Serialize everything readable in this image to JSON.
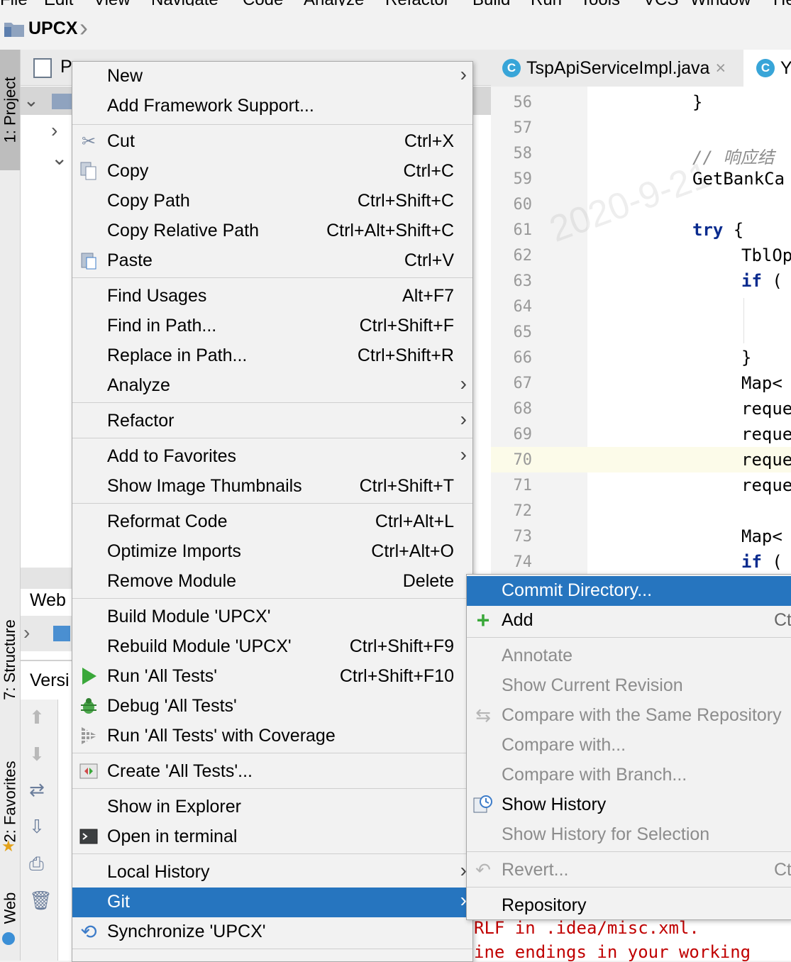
{
  "menubar": [
    "File",
    "Edit",
    "View",
    "Navigate",
    "Code",
    "Analyze",
    "Refactor",
    "Build",
    "Run",
    "Tools",
    "VCS",
    "Window",
    "Help"
  ],
  "navbar": {
    "project_name": "UPCX"
  },
  "left_stripe": {
    "project_tab": "1: Project",
    "structure_tab": "7: Structure",
    "favorites_tab": "2: Favorites",
    "web_tab": "Web"
  },
  "project_panel": {
    "title_initial": "P"
  },
  "web_panel": {
    "title": "Web"
  },
  "version_panel": {
    "title": "Versi"
  },
  "editor": {
    "tabs": [
      {
        "badge": "C",
        "label": "TspApiServiceImpl.java",
        "close": "×"
      },
      {
        "badge": "C",
        "label": "Y"
      }
    ],
    "lines": [
      {
        "n": "56",
        "code": "}"
      },
      {
        "n": "57",
        "code": ""
      },
      {
        "n": "58",
        "code": "// 响应结"
      },
      {
        "n": "59",
        "code": "GetBankCa"
      },
      {
        "n": "60",
        "code": ""
      },
      {
        "n": "61",
        "kw": "try",
        "code": " {"
      },
      {
        "n": "62",
        "code": "TblOp"
      },
      {
        "n": "63",
        "kw": "if",
        "code": " ("
      },
      {
        "n": "64",
        "code": ""
      },
      {
        "n": "65",
        "code": ""
      },
      {
        "n": "66",
        "code": "}"
      },
      {
        "n": "67",
        "code": "Map<"
      },
      {
        "n": "68",
        "code": "reque"
      },
      {
        "n": "69",
        "code": "reque"
      },
      {
        "n": "70",
        "code": "reque"
      },
      {
        "n": "71",
        "code": "reque"
      },
      {
        "n": "72",
        "code": ""
      },
      {
        "n": "73",
        "code": "Map<"
      },
      {
        "n": "74",
        "kw": "if",
        "code": " ("
      }
    ],
    "watermark": "2020-9-21"
  },
  "console": {
    "line1": "RLF in .idea/misc.xml.",
    "line2": "ine endings in your working"
  },
  "context_menu": {
    "new": {
      "label": "New"
    },
    "add_framework": {
      "label": "Add Framework Support..."
    },
    "cut": {
      "label": "Cut",
      "shortcut": "Ctrl+X"
    },
    "copy": {
      "label": "Copy",
      "shortcut": "Ctrl+C"
    },
    "copy_path": {
      "label": "Copy Path",
      "shortcut": "Ctrl+Shift+C"
    },
    "copy_relative_path": {
      "label": "Copy Relative Path",
      "shortcut": "Ctrl+Alt+Shift+C"
    },
    "paste": {
      "label": "Paste",
      "shortcut": "Ctrl+V"
    },
    "find_usages": {
      "label": "Find Usages",
      "shortcut": "Alt+F7"
    },
    "find_in_path": {
      "label": "Find in Path...",
      "shortcut": "Ctrl+Shift+F"
    },
    "replace_in_path": {
      "label": "Replace in Path...",
      "shortcut": "Ctrl+Shift+R"
    },
    "analyze": {
      "label": "Analyze"
    },
    "refactor": {
      "label": "Refactor"
    },
    "add_to_favorites": {
      "label": "Add to Favorites"
    },
    "show_image_thumbnails": {
      "label": "Show Image Thumbnails",
      "shortcut": "Ctrl+Shift+T"
    },
    "reformat_code": {
      "label": "Reformat Code",
      "shortcut": "Ctrl+Alt+L"
    },
    "optimize_imports": {
      "label": "Optimize Imports",
      "shortcut": "Ctrl+Alt+O"
    },
    "remove_module": {
      "label": "Remove Module",
      "shortcut": "Delete"
    },
    "build_module": {
      "label": "Build Module 'UPCX'"
    },
    "rebuild_module": {
      "label": "Rebuild Module 'UPCX'",
      "shortcut": "Ctrl+Shift+F9"
    },
    "run_tests": {
      "label": "Run 'All Tests'",
      "shortcut": "Ctrl+Shift+F10"
    },
    "debug_tests": {
      "label": "Debug 'All Tests'"
    },
    "run_coverage": {
      "label": "Run 'All Tests' with Coverage"
    },
    "create_tests": {
      "label": "Create 'All Tests'..."
    },
    "show_in_explorer": {
      "label": "Show in Explorer"
    },
    "open_in_terminal": {
      "label": "Open in terminal"
    },
    "local_history": {
      "label": "Local History"
    },
    "git": {
      "label": "Git"
    },
    "synchronize": {
      "label": "Synchronize 'UPCX'"
    }
  },
  "git_submenu": {
    "commit_directory": {
      "label": "Commit Directory..."
    },
    "add": {
      "label": "Add",
      "shortcut": "Ct"
    },
    "annotate": {
      "label": "Annotate"
    },
    "show_current_revision": {
      "label": "Show Current Revision"
    },
    "compare_same_repo": {
      "label": "Compare with the Same Repository"
    },
    "compare_with": {
      "label": "Compare with..."
    },
    "compare_branch": {
      "label": "Compare with Branch..."
    },
    "show_history": {
      "label": "Show History"
    },
    "show_history_selection": {
      "label": "Show History for Selection"
    },
    "revert": {
      "label": "Revert...",
      "shortcut": "Ct"
    },
    "repository": {
      "label": "Repository"
    }
  },
  "colors": {
    "selection": "#2675bf",
    "menu_bg": "#f2f2f2",
    "keyword": "#0a2b8e",
    "run_green": "#3aa83a",
    "console_red": "#c00000"
  }
}
